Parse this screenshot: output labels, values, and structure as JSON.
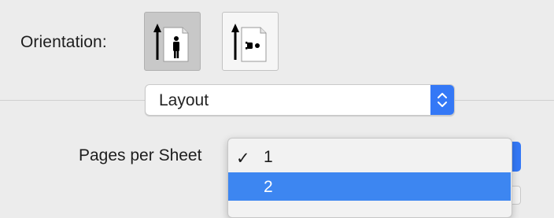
{
  "orientation": {
    "label": "Orientation:",
    "options": [
      {
        "name": "portrait",
        "icon": "portrait-orientation-icon",
        "selected": true
      },
      {
        "name": "landscape",
        "icon": "landscape-orientation-icon",
        "selected": false
      }
    ]
  },
  "layout_popup": {
    "selected": "Layout",
    "icon": "up-down-chevron-icon"
  },
  "pages_per_sheet": {
    "label": "Pages per Sheet",
    "selected": "1",
    "menu": {
      "items": [
        {
          "value": "1",
          "checked": true,
          "highlighted": false
        },
        {
          "value": "2",
          "checked": false,
          "highlighted": true
        }
      ],
      "check_glyph": "✓"
    }
  },
  "colors": {
    "accent": "#3478f6",
    "highlight": "#3d86f1",
    "background": "#ececec"
  }
}
